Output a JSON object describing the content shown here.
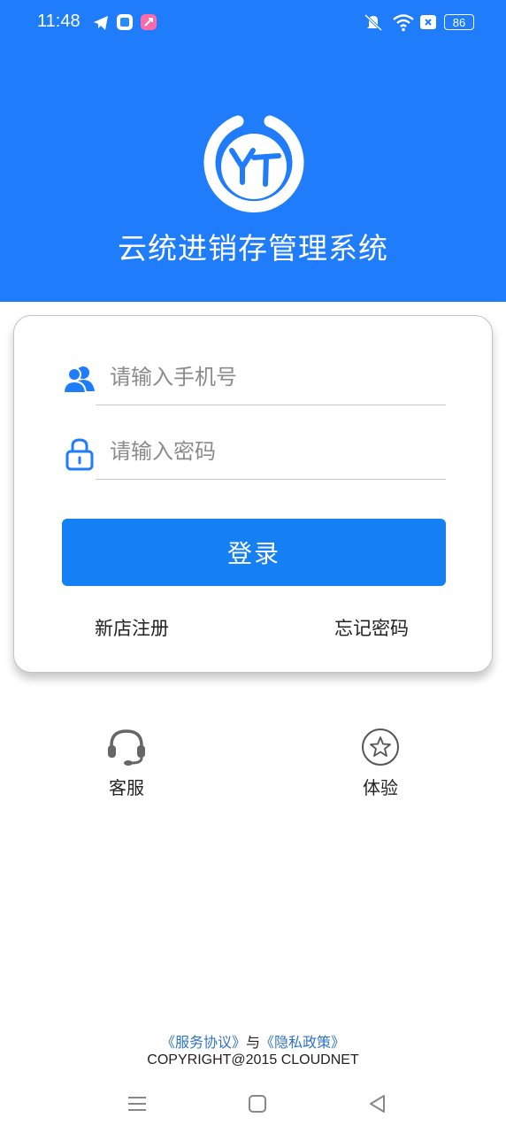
{
  "status_bar": {
    "time": "11:48",
    "battery": "86",
    "icons": [
      "telegram-icon",
      "app-icon",
      "app-icon-2",
      "mute-icon",
      "wifi-icon",
      "sim-off-icon",
      "battery-icon"
    ]
  },
  "app": {
    "logo_text": "YT",
    "title": "云统进销存管理系统",
    "header_color": "#1f7cfb"
  },
  "login": {
    "phone_placeholder": "请输入手机号",
    "password_placeholder": "请输入密码",
    "login_label": "登录",
    "register_label": "新店注册",
    "forgot_label": "忘记密码"
  },
  "quick_actions": {
    "service_label": "客服",
    "trial_label": "体验"
  },
  "footer": {
    "terms": "《服务协议》",
    "and": "与",
    "privacy": "《隐私政策》",
    "copyright": "COPYRIGHT@2015 CLOUDNET"
  },
  "nav": {
    "icons": [
      "menu-icon",
      "home-icon",
      "back-icon"
    ]
  }
}
